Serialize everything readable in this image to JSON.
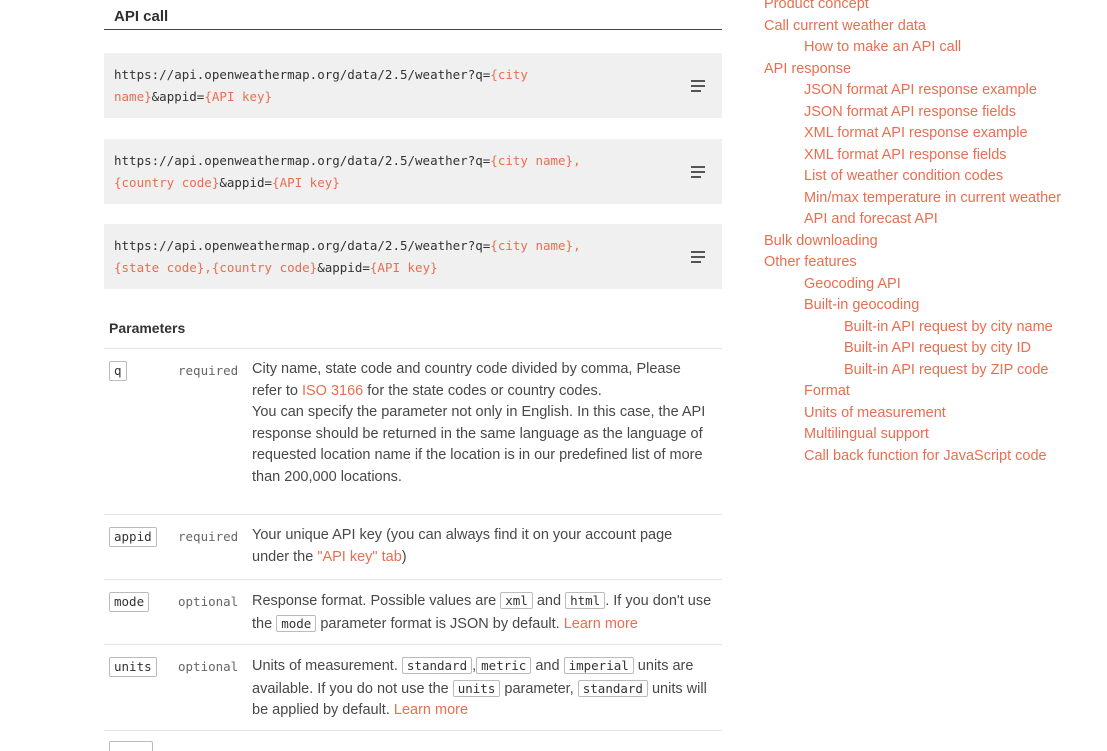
{
  "api_call": {
    "title": "API call",
    "urls": [
      {
        "prefix": "https://api.openweathermap.org/data/2.5/weather?q=",
        "p1": "{city",
        "br": "",
        "p2": "name}",
        "mid": "&appid=",
        "p3": "{API key}",
        "tail": "",
        "p4": "",
        "end": ""
      },
      {
        "prefix": "https://api.openweathermap.org/data/2.5/weather?q=",
        "p1": "{city name},",
        "br": "",
        "p2": "{country code}",
        "mid": "&appid=",
        "p3": "{API key}",
        "tail": "",
        "p4": "",
        "end": ""
      },
      {
        "prefix": "https://api.openweathermap.org/data/2.5/weather?q=",
        "p1": "{city name},",
        "br": "",
        "p2": "{state code},{country code}",
        "mid": "&appid=",
        "p3": "{API key}",
        "tail": "",
        "p4": "",
        "end": ""
      }
    ],
    "copy_icon": "copy-icon"
  },
  "parameters": {
    "title": "Parameters",
    "q": {
      "name": "q",
      "req": "required",
      "d1": "City name, state code and country code divided by comma, Please refer to ",
      "link": "ISO 3166",
      "d2": " for the state codes or country codes.",
      "d3": "You can specify the parameter not only in English. In this case, the API response should be returned in the same language as the language of requested location name if the location is in our predefined list of more than 200,000 locations."
    },
    "appid": {
      "name": "appid",
      "req": "required",
      "d1": "Your unique API key (you can always find it on your account page under the ",
      "link": "\"API key\" tab",
      "d2": ")"
    },
    "mode": {
      "name": "mode",
      "req": "optional",
      "d1": "Response format. Possible values are ",
      "c1": "xml",
      "d2": " and ",
      "c2": "html",
      "d3": ". If you don't use the ",
      "c3": "mode",
      "d4": " parameter format is JSON by default. ",
      "link": "Learn more"
    },
    "units": {
      "name": "units",
      "req": "optional",
      "d1": "Units of measurement. ",
      "c1": "standard",
      "s1": ",",
      "c2": "metric",
      "d2": " and ",
      "c3": "imperial",
      "d3": " units are available. If you do not use the ",
      "c4": "units",
      "d4": " parameter, ",
      "c5": "standard",
      "d5": " units will be applied by default. ",
      "link": "Learn more"
    }
  },
  "toc": {
    "items": [
      {
        "label": "Product concept",
        "level": 1
      },
      {
        "label": "Call current weather data",
        "level": 1
      },
      {
        "label": "How to make an API call",
        "level": 2
      },
      {
        "label": "API response",
        "level": 1
      },
      {
        "label": "JSON format API response example",
        "level": 2
      },
      {
        "label": "JSON format API response fields",
        "level": 2
      },
      {
        "label": "XML format API response example",
        "level": 2
      },
      {
        "label": "XML format API response fields",
        "level": 2
      },
      {
        "label": "List of weather condition codes",
        "level": 2
      },
      {
        "label": "Min/max temperature in current weather",
        "level": 2
      },
      {
        "label": "API and forecast API",
        "level": 2
      },
      {
        "label": "Bulk downloading",
        "level": 1
      },
      {
        "label": "Other features",
        "level": 1
      },
      {
        "label": "Geocoding API",
        "level": 2
      },
      {
        "label": "Built-in geocoding",
        "level": 2
      },
      {
        "label": "Built-in API request by city name",
        "level": 3
      },
      {
        "label": "Built-in API request by city ID",
        "level": 3
      },
      {
        "label": "Built-in API request by ZIP code",
        "level": 3
      },
      {
        "label": "Format",
        "level": 2
      },
      {
        "label": "Units of measurement",
        "level": 2
      },
      {
        "label": "Multilingual support",
        "level": 2
      },
      {
        "label": "Call back function for JavaScript code",
        "level": 2
      }
    ]
  },
  "colors": {
    "link": "#e96e50",
    "code_bg": "#f0f0f0",
    "text": "#48484a"
  }
}
